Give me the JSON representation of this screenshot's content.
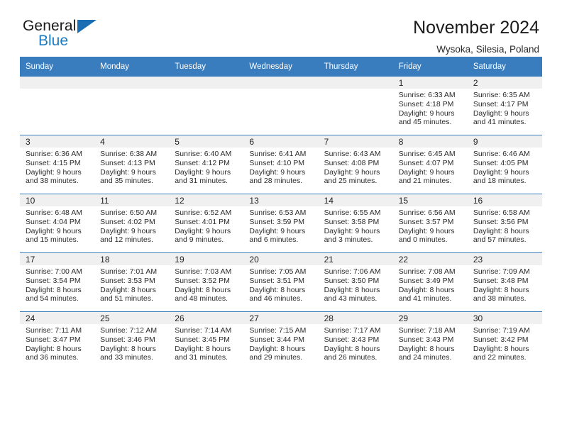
{
  "brand": {
    "name_part1": "General",
    "name_part2": "Blue",
    "accent_color": "#1a7bc4",
    "logo_icon": "triangle-icon"
  },
  "header": {
    "title": "November 2024",
    "subtitle": "Wysoka, Silesia, Poland"
  },
  "colors": {
    "header_row_bg": "#3a7dbf",
    "daynum_band_bg": "#f0f0f0",
    "row_divider": "#3a7dbf",
    "text": "#222222"
  },
  "weekday_headers": [
    "Sunday",
    "Monday",
    "Tuesday",
    "Wednesday",
    "Thursday",
    "Friday",
    "Saturday"
  ],
  "labels": {
    "sunrise_prefix": "Sunrise:",
    "sunset_prefix": "Sunset:",
    "daylight_prefix": "Daylight:"
  },
  "weeks": [
    [
      {
        "day": "",
        "empty": true
      },
      {
        "day": "",
        "empty": true
      },
      {
        "day": "",
        "empty": true
      },
      {
        "day": "",
        "empty": true
      },
      {
        "day": "",
        "empty": true
      },
      {
        "day": "1",
        "sunrise": "Sunrise: 6:33 AM",
        "sunset": "Sunset: 4:18 PM",
        "daylight1": "Daylight: 9 hours",
        "daylight2": "and 45 minutes."
      },
      {
        "day": "2",
        "sunrise": "Sunrise: 6:35 AM",
        "sunset": "Sunset: 4:17 PM",
        "daylight1": "Daylight: 9 hours",
        "daylight2": "and 41 minutes."
      }
    ],
    [
      {
        "day": "3",
        "sunrise": "Sunrise: 6:36 AM",
        "sunset": "Sunset: 4:15 PM",
        "daylight1": "Daylight: 9 hours",
        "daylight2": "and 38 minutes."
      },
      {
        "day": "4",
        "sunrise": "Sunrise: 6:38 AM",
        "sunset": "Sunset: 4:13 PM",
        "daylight1": "Daylight: 9 hours",
        "daylight2": "and 35 minutes."
      },
      {
        "day": "5",
        "sunrise": "Sunrise: 6:40 AM",
        "sunset": "Sunset: 4:12 PM",
        "daylight1": "Daylight: 9 hours",
        "daylight2": "and 31 minutes."
      },
      {
        "day": "6",
        "sunrise": "Sunrise: 6:41 AM",
        "sunset": "Sunset: 4:10 PM",
        "daylight1": "Daylight: 9 hours",
        "daylight2": "and 28 minutes."
      },
      {
        "day": "7",
        "sunrise": "Sunrise: 6:43 AM",
        "sunset": "Sunset: 4:08 PM",
        "daylight1": "Daylight: 9 hours",
        "daylight2": "and 25 minutes."
      },
      {
        "day": "8",
        "sunrise": "Sunrise: 6:45 AM",
        "sunset": "Sunset: 4:07 PM",
        "daylight1": "Daylight: 9 hours",
        "daylight2": "and 21 minutes."
      },
      {
        "day": "9",
        "sunrise": "Sunrise: 6:46 AM",
        "sunset": "Sunset: 4:05 PM",
        "daylight1": "Daylight: 9 hours",
        "daylight2": "and 18 minutes."
      }
    ],
    [
      {
        "day": "10",
        "sunrise": "Sunrise: 6:48 AM",
        "sunset": "Sunset: 4:04 PM",
        "daylight1": "Daylight: 9 hours",
        "daylight2": "and 15 minutes."
      },
      {
        "day": "11",
        "sunrise": "Sunrise: 6:50 AM",
        "sunset": "Sunset: 4:02 PM",
        "daylight1": "Daylight: 9 hours",
        "daylight2": "and 12 minutes."
      },
      {
        "day": "12",
        "sunrise": "Sunrise: 6:52 AM",
        "sunset": "Sunset: 4:01 PM",
        "daylight1": "Daylight: 9 hours",
        "daylight2": "and 9 minutes."
      },
      {
        "day": "13",
        "sunrise": "Sunrise: 6:53 AM",
        "sunset": "Sunset: 3:59 PM",
        "daylight1": "Daylight: 9 hours",
        "daylight2": "and 6 minutes."
      },
      {
        "day": "14",
        "sunrise": "Sunrise: 6:55 AM",
        "sunset": "Sunset: 3:58 PM",
        "daylight1": "Daylight: 9 hours",
        "daylight2": "and 3 minutes."
      },
      {
        "day": "15",
        "sunrise": "Sunrise: 6:56 AM",
        "sunset": "Sunset: 3:57 PM",
        "daylight1": "Daylight: 9 hours",
        "daylight2": "and 0 minutes."
      },
      {
        "day": "16",
        "sunrise": "Sunrise: 6:58 AM",
        "sunset": "Sunset: 3:56 PM",
        "daylight1": "Daylight: 8 hours",
        "daylight2": "and 57 minutes."
      }
    ],
    [
      {
        "day": "17",
        "sunrise": "Sunrise: 7:00 AM",
        "sunset": "Sunset: 3:54 PM",
        "daylight1": "Daylight: 8 hours",
        "daylight2": "and 54 minutes."
      },
      {
        "day": "18",
        "sunrise": "Sunrise: 7:01 AM",
        "sunset": "Sunset: 3:53 PM",
        "daylight1": "Daylight: 8 hours",
        "daylight2": "and 51 minutes."
      },
      {
        "day": "19",
        "sunrise": "Sunrise: 7:03 AM",
        "sunset": "Sunset: 3:52 PM",
        "daylight1": "Daylight: 8 hours",
        "daylight2": "and 48 minutes."
      },
      {
        "day": "20",
        "sunrise": "Sunrise: 7:05 AM",
        "sunset": "Sunset: 3:51 PM",
        "daylight1": "Daylight: 8 hours",
        "daylight2": "and 46 minutes."
      },
      {
        "day": "21",
        "sunrise": "Sunrise: 7:06 AM",
        "sunset": "Sunset: 3:50 PM",
        "daylight1": "Daylight: 8 hours",
        "daylight2": "and 43 minutes."
      },
      {
        "day": "22",
        "sunrise": "Sunrise: 7:08 AM",
        "sunset": "Sunset: 3:49 PM",
        "daylight1": "Daylight: 8 hours",
        "daylight2": "and 41 minutes."
      },
      {
        "day": "23",
        "sunrise": "Sunrise: 7:09 AM",
        "sunset": "Sunset: 3:48 PM",
        "daylight1": "Daylight: 8 hours",
        "daylight2": "and 38 minutes."
      }
    ],
    [
      {
        "day": "24",
        "sunrise": "Sunrise: 7:11 AM",
        "sunset": "Sunset: 3:47 PM",
        "daylight1": "Daylight: 8 hours",
        "daylight2": "and 36 minutes."
      },
      {
        "day": "25",
        "sunrise": "Sunrise: 7:12 AM",
        "sunset": "Sunset: 3:46 PM",
        "daylight1": "Daylight: 8 hours",
        "daylight2": "and 33 minutes."
      },
      {
        "day": "26",
        "sunrise": "Sunrise: 7:14 AM",
        "sunset": "Sunset: 3:45 PM",
        "daylight1": "Daylight: 8 hours",
        "daylight2": "and 31 minutes."
      },
      {
        "day": "27",
        "sunrise": "Sunrise: 7:15 AM",
        "sunset": "Sunset: 3:44 PM",
        "daylight1": "Daylight: 8 hours",
        "daylight2": "and 29 minutes."
      },
      {
        "day": "28",
        "sunrise": "Sunrise: 7:17 AM",
        "sunset": "Sunset: 3:43 PM",
        "daylight1": "Daylight: 8 hours",
        "daylight2": "and 26 minutes."
      },
      {
        "day": "29",
        "sunrise": "Sunrise: 7:18 AM",
        "sunset": "Sunset: 3:43 PM",
        "daylight1": "Daylight: 8 hours",
        "daylight2": "and 24 minutes."
      },
      {
        "day": "30",
        "sunrise": "Sunrise: 7:19 AM",
        "sunset": "Sunset: 3:42 PM",
        "daylight1": "Daylight: 8 hours",
        "daylight2": "and 22 minutes."
      }
    ]
  ]
}
